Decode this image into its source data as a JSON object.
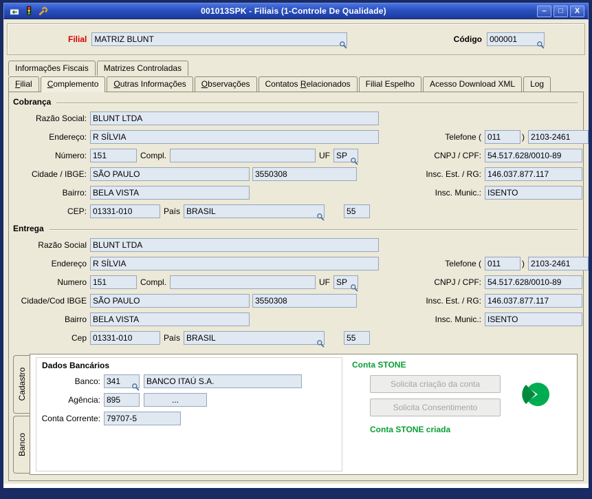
{
  "window": {
    "title": "001013SPK - Filiais (1-Controle De Qualidade)",
    "controls": {
      "minimize": "–",
      "maximize": "□",
      "close": "X"
    },
    "titlebar_icons": [
      "exit-window-icon",
      "traffic-light-icon",
      "wrench-icon"
    ]
  },
  "colors": {
    "titlebar_blue": "#2a50c0",
    "frame_navy": "#1A2B63",
    "content_beige": "#ECE9D8",
    "field_bg": "#E0E8F2",
    "filial_label_red": "#d40000",
    "status_green": "#0B9E35",
    "stone_green": "#00AC52"
  },
  "header": {
    "filial_label": "Filial",
    "filial_value": "MATRIZ BLUNT",
    "codigo_label": "Código",
    "codigo_value": "000001"
  },
  "tabs": {
    "back_row": [
      {
        "label": "Informações Fiscais"
      },
      {
        "label": "Matrizes Controladas"
      }
    ],
    "front_row": [
      {
        "label": "Filial"
      },
      {
        "label": "Complemento",
        "active": true
      },
      {
        "label": "Outras Informações"
      },
      {
        "label": "Observações"
      },
      {
        "label": "Contatos Relacionados"
      },
      {
        "label": "Filial Espelho"
      },
      {
        "label": "Acesso Download XML"
      },
      {
        "label": "Log"
      }
    ]
  },
  "cobranca": {
    "title": "Cobrança",
    "razao_label": "Razão Social:",
    "razao": "BLUNT LTDA",
    "endereco_label": "Endereço:",
    "endereco": "R SÍLVIA",
    "numero_label": "Número:",
    "numero": "151",
    "compl_label": "Compl.",
    "compl": "",
    "uf_label": "UF",
    "uf": "SP",
    "cidade_label": "Cidade / IBGE:",
    "cidade": "SÃO PAULO",
    "ibge": "3550308",
    "bairro_label": "Bairro:",
    "bairro": "BELA VISTA",
    "cep_label": "CEP:",
    "cep": "01331-010",
    "pais_label": "País",
    "pais": "BRASIL",
    "ddi": "55",
    "telefone_label": "Telefone (",
    "telefone_close": ")",
    "ddd": "011",
    "telefone": "2103-2461",
    "cnpj_label": "CNPJ / CPF:",
    "cnpj": "54.517.628/0010-89",
    "inscest_label": "Insc. Est. / RG:",
    "inscest": "146.037.877.117",
    "inscmun_label": "Insc. Munic.:",
    "inscmun": "ISENTO"
  },
  "entrega": {
    "title": "Entrega",
    "razao_label": "Razão Social",
    "razao": "BLUNT LTDA",
    "endereco_label": "Endereço",
    "endereco": "R SÍLVIA",
    "numero_label": "Numero",
    "numero": "151",
    "compl_label": "Compl.",
    "compl": "",
    "uf_label": "UF",
    "uf": "SP",
    "cidade_label": "Cidade/Cod IBGE",
    "cidade": "SÃO PAULO",
    "ibge": "3550308",
    "bairro_label": "Bairro",
    "bairro": "BELA VISTA",
    "cep_label": "Cep",
    "cep": "01331-010",
    "pais_label": "País",
    "pais": "BRASIL",
    "ddi": "55",
    "telefone_label": "Telefone (",
    "telefone_close": ")",
    "ddd": "011",
    "telefone": "2103-2461",
    "cnpj_label": "CNPJ / CPF:",
    "cnpj": "54.517.628/0010-89",
    "inscest_label": "Insc. Est. / RG:",
    "inscest": "146.037.877.117",
    "inscmun_label": "Insc. Munic.:",
    "inscmun": "ISENTO"
  },
  "bottom": {
    "side_tabs": [
      {
        "label": "Cadastro"
      },
      {
        "label": "Banco",
        "active": true
      }
    ],
    "dados_bancarios": {
      "title": "Dados Bancários",
      "banco_label": "Banco:",
      "banco_codigo": "341",
      "banco_nome": "BANCO ITAÚ S.A.",
      "agencia_label": "Agência:",
      "agencia": "895",
      "agencia_extra": "...",
      "conta_label": "Conta Corrente:",
      "conta": "79707-5"
    },
    "conta_stone": {
      "title": "Conta STONE",
      "botao_criacao": "Solicita criação da conta",
      "botao_consentimento": "Solicita Consentimento",
      "status": "Conta STONE criada"
    }
  }
}
